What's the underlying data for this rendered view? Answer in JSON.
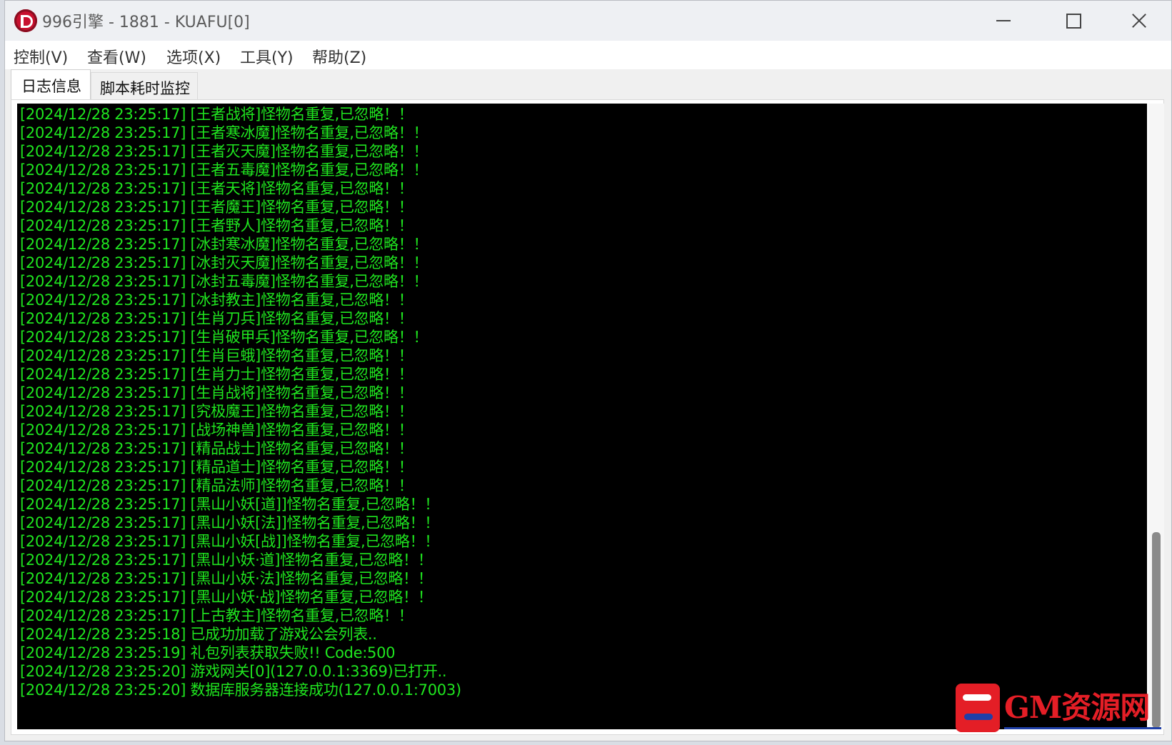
{
  "window": {
    "title": "996引擎 - 1881 - KUAFU[0]",
    "icon": "d-logo-icon"
  },
  "menu": [
    {
      "label": "控制(V)"
    },
    {
      "label": "查看(W)"
    },
    {
      "label": "选项(X)"
    },
    {
      "label": "工具(Y)"
    },
    {
      "label": "帮助(Z)"
    }
  ],
  "tabs": [
    {
      "label": "日志信息",
      "active": true
    },
    {
      "label": "脚本耗时监控",
      "active": false
    }
  ],
  "log_color": "#1fe51f",
  "log": [
    "[2024/12/28 23:25:17] [王者战将]怪物名重复,已忽略！！",
    "[2024/12/28 23:25:17] [王者寒冰魔]怪物名重复,已忽略！！",
    "[2024/12/28 23:25:17] [王者灭天魔]怪物名重复,已忽略！！",
    "[2024/12/28 23:25:17] [王者五毒魔]怪物名重复,已忽略！！",
    "[2024/12/28 23:25:17] [王者天将]怪物名重复,已忽略！！",
    "[2024/12/28 23:25:17] [王者魔王]怪物名重复,已忽略！！",
    "[2024/12/28 23:25:17] [王者野人]怪物名重复,已忽略！！",
    "[2024/12/28 23:25:17] [冰封寒冰魔]怪物名重复,已忽略！！",
    "[2024/12/28 23:25:17] [冰封灭天魔]怪物名重复,已忽略！！",
    "[2024/12/28 23:25:17] [冰封五毒魔]怪物名重复,已忽略！！",
    "[2024/12/28 23:25:17] [冰封教主]怪物名重复,已忽略！！",
    "[2024/12/28 23:25:17] [生肖刀兵]怪物名重复,已忽略！！",
    "[2024/12/28 23:25:17] [生肖破甲兵]怪物名重复,已忽略！！",
    "[2024/12/28 23:25:17] [生肖巨蛾]怪物名重复,已忽略！！",
    "[2024/12/28 23:25:17] [生肖力士]怪物名重复,已忽略！！",
    "[2024/12/28 23:25:17] [生肖战将]怪物名重复,已忽略！！",
    "[2024/12/28 23:25:17] [究极魔王]怪物名重复,已忽略！！",
    "[2024/12/28 23:25:17] [战场神兽]怪物名重复,已忽略！！",
    "[2024/12/28 23:25:17] [精品战士]怪物名重复,已忽略！！",
    "[2024/12/28 23:25:17] [精品道士]怪物名重复,已忽略！！",
    "[2024/12/28 23:25:17] [精品法师]怪物名重复,已忽略！！",
    "[2024/12/28 23:25:17] [黑山小妖[道]]怪物名重复,已忽略！！",
    "[2024/12/28 23:25:17] [黑山小妖[法]]怪物名重复,已忽略！！",
    "[2024/12/28 23:25:17] [黑山小妖[战]]怪物名重复,已忽略！！",
    "[2024/12/28 23:25:17] [黑山小妖·道]怪物名重复,已忽略！！",
    "[2024/12/28 23:25:17] [黑山小妖·法]怪物名重复,已忽略！！",
    "[2024/12/28 23:25:17] [黑山小妖·战]怪物名重复,已忽略！！",
    "[2024/12/28 23:25:17] [上古教主]怪物名重复,已忽略！！",
    "[2024/12/28 23:25:18] 已成功加载了游戏公会列表..",
    "[2024/12/28 23:25:19] 礼包列表获取失败!! Code:500",
    "[2024/12/28 23:25:20] 游戏网关[0](127.0.0.1:3369)已打开..",
    "[2024/12/28 23:25:20] 数据库服务器连接成功(127.0.0.1:7003)"
  ],
  "watermark": {
    "text": "GM资源网",
    "icon": "gm-logo-icon"
  }
}
